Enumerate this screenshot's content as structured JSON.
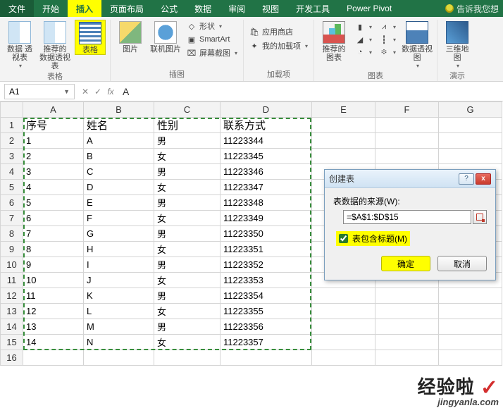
{
  "tabs": {
    "file": "文件",
    "home": "开始",
    "insert": "插入",
    "layout": "页面布局",
    "formulas": "公式",
    "data": "数据",
    "review": "审阅",
    "view": "视图",
    "dev": "开发工具",
    "powerpivot": "Power Pivot",
    "tell": "告诉我您想"
  },
  "ribbon": {
    "pivot": "数据\n透视表",
    "recommendpivot": "推荐的\n数据透视表",
    "table": "表格",
    "group_tables": "表格",
    "pic": "图片",
    "onlinepic": "联机图片",
    "shapes": "形状",
    "smartart": "SmartArt",
    "screenshot": "屏幕截图",
    "group_illus": "插图",
    "store": "应用商店",
    "myaddins": "我的加载项",
    "group_addins": "加载项",
    "recommendchart": "推荐的\n图表",
    "pivotchart": "数据透视图",
    "group_charts": "图表",
    "threed": "三维地\n图",
    "group_demo": "演示"
  },
  "formula_bar": {
    "name": "A1",
    "fx": "fx",
    "content": "A"
  },
  "columns": [
    "A",
    "B",
    "C",
    "D",
    "E",
    "F",
    "G"
  ],
  "headers": {
    "A": "序号",
    "B": "姓名",
    "C": "性别",
    "D": "联系方式"
  },
  "rows": [
    {
      "n": "1",
      "a": "1",
      "b": "A",
      "c": "男",
      "d": "11223344"
    },
    {
      "n": "2",
      "a": "2",
      "b": "B",
      "c": "女",
      "d": "11223345"
    },
    {
      "n": "3",
      "a": "3",
      "b": "C",
      "c": "男",
      "d": "11223346"
    },
    {
      "n": "4",
      "a": "4",
      "b": "D",
      "c": "女",
      "d": "11223347"
    },
    {
      "n": "5",
      "a": "5",
      "b": "E",
      "c": "男",
      "d": "11223348"
    },
    {
      "n": "6",
      "a": "6",
      "b": "F",
      "c": "女",
      "d": "11223349"
    },
    {
      "n": "7",
      "a": "7",
      "b": "G",
      "c": "男",
      "d": "11223350"
    },
    {
      "n": "8",
      "a": "8",
      "b": "H",
      "c": "女",
      "d": "11223351"
    },
    {
      "n": "9",
      "a": "9",
      "b": "I",
      "c": "男",
      "d": "11223352"
    },
    {
      "n": "10",
      "a": "10",
      "b": "J",
      "c": "女",
      "d": "11223353"
    },
    {
      "n": "11",
      "a": "11",
      "b": "K",
      "c": "男",
      "d": "11223354"
    },
    {
      "n": "12",
      "a": "12",
      "b": "L",
      "c": "女",
      "d": "11223355"
    },
    {
      "n": "13",
      "a": "13",
      "b": "M",
      "c": "男",
      "d": "11223356"
    },
    {
      "n": "14",
      "a": "14",
      "b": "N",
      "c": "女",
      "d": "11223357"
    }
  ],
  "extra_row": "16",
  "dialog": {
    "title": "创建表",
    "help": "?",
    "close": "x",
    "src_label": "表数据的来源(W):",
    "src_value": "=$A$1:$D$15",
    "chk_label": "表包含标题(M)",
    "ok": "确定",
    "cancel": "取消"
  },
  "watermark": {
    "big": "经验啦",
    "small": "jingyanla.com"
  }
}
